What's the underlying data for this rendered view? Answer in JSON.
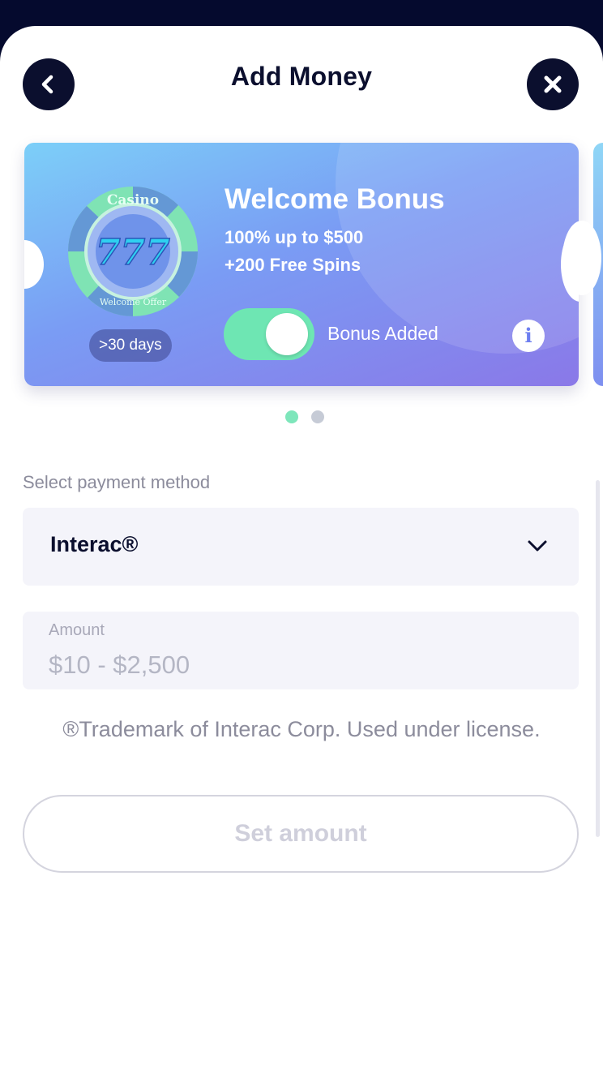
{
  "header": {
    "title": "Add Money",
    "back_icon": "chevron-left-icon",
    "close_icon": "close-icon"
  },
  "bonus_card": {
    "chip_top_text": "Casino",
    "chip_center_text": "777",
    "chip_bottom_text": "Welcome Offer",
    "days_badge": ">30 days",
    "title": "Welcome Bonus",
    "line1": "100% up to $500",
    "line2": "+200 Free Spins",
    "toggle_on": true,
    "toggle_label": "Bonus Added",
    "info_icon": "i"
  },
  "carousel": {
    "total": 2,
    "active_index": 0
  },
  "payment": {
    "label": "Select payment method",
    "selected": "Interac®"
  },
  "amount": {
    "label": "Amount",
    "placeholder": "$10 - $2,500",
    "value": ""
  },
  "trademark_note": "®Trademark of Interac Corp. Used under license.",
  "submit_label": "Set amount",
  "colors": {
    "navy": "#0b0f2e",
    "accent_green": "#6ee6b3",
    "card_gradient_start": "#7ccff8",
    "card_gradient_end": "#8a78e8",
    "field_bg": "#f4f4fa"
  }
}
